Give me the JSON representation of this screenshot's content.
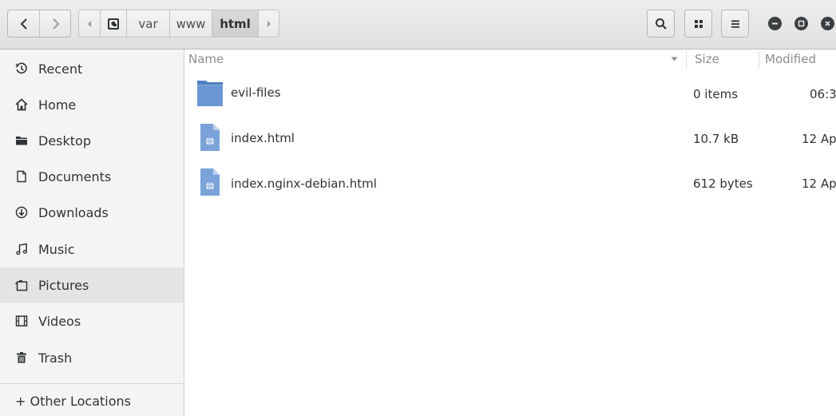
{
  "header": {
    "breadcrumbs": [
      "var",
      "www",
      "html"
    ],
    "search_icon": "search-icon",
    "view_icon": "grid-view-icon",
    "menu_icon": "hamburger-menu-icon"
  },
  "sidebar": {
    "items": [
      {
        "label": "Recent",
        "icon": "clock-icon"
      },
      {
        "label": "Home",
        "icon": "home-icon"
      },
      {
        "label": "Desktop",
        "icon": "folder-icon"
      },
      {
        "label": "Documents",
        "icon": "document-icon"
      },
      {
        "label": "Downloads",
        "icon": "download-icon"
      },
      {
        "label": "Music",
        "icon": "music-icon"
      },
      {
        "label": "Pictures",
        "icon": "picture-icon"
      },
      {
        "label": "Videos",
        "icon": "film-icon"
      },
      {
        "label": "Trash",
        "icon": "trash-icon"
      }
    ],
    "other_locations": "+ Other Locations",
    "selected_index": 6
  },
  "columns": {
    "name": "Name",
    "size": "Size",
    "modified": "Modified"
  },
  "files": [
    {
      "name": "evil-files",
      "size": "0 items",
      "modified": "06:3",
      "type": "folder"
    },
    {
      "name": "index.html",
      "size": "10.7 kB",
      "modified": "12 Ap",
      "type": "html"
    },
    {
      "name": "index.nginx-debian.html",
      "size": "612 bytes",
      "modified": "12 Ap",
      "type": "html"
    }
  ],
  "colors": {
    "accent": "#4a90d9",
    "folder": "#5b8ac9",
    "sidebar_bg": "#f4f4f3",
    "selected_bg": "#e4e4e2"
  }
}
